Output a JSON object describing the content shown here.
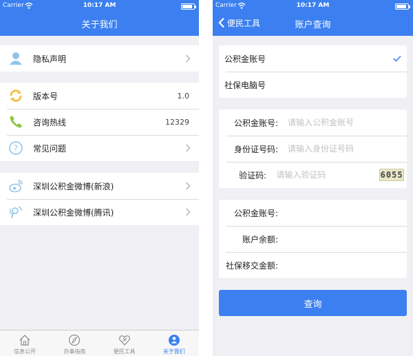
{
  "left": {
    "status": {
      "carrier": "Carrier",
      "time": "10:17 AM",
      "battery_level": 0.9
    },
    "nav_title": "关于我们",
    "groups": [
      [
        {
          "label": "隐私声明",
          "icon": "user-icon",
          "chevron": true
        }
      ],
      [
        {
          "label": "版本号",
          "icon": "refresh-icon",
          "value": "1.0"
        },
        {
          "label": "咨询热线",
          "icon": "phone-icon",
          "value": "12329"
        },
        {
          "label": "常见问题",
          "icon": "question-icon",
          "chevron": true
        }
      ],
      [
        {
          "label": "深圳公积金微博(新浪)",
          "icon": "sina-weibo-icon",
          "chevron": true
        },
        {
          "label": "深圳公积金微博(腾讯)",
          "icon": "tencent-weibo-icon",
          "chevron": true
        }
      ]
    ],
    "tabs": [
      {
        "label": "信息公开",
        "icon": "home-icon"
      },
      {
        "label": "办事指南",
        "icon": "compass-icon"
      },
      {
        "label": "便民工具",
        "icon": "heart-tools-icon"
      },
      {
        "label": "关于我们",
        "icon": "about-icon",
        "active": true
      }
    ]
  },
  "right": {
    "status": {
      "carrier": "Carrier",
      "time": "10:17 AM",
      "battery_level": 0.9
    },
    "back_label": "便民工具",
    "nav_title": "账户查询",
    "options": [
      {
        "label": "公积金账号",
        "selected": true
      },
      {
        "label": "社保电脑号",
        "selected": false
      }
    ],
    "form": {
      "account": {
        "label": "公积金账号:",
        "placeholder": "请输入公积金账号"
      },
      "id_number": {
        "label": "身份证号码:",
        "placeholder": "请输入身份证号码"
      },
      "captcha": {
        "label": "验证码:",
        "placeholder": "请输入验证码",
        "code": "6055"
      }
    },
    "results": [
      {
        "label": "公积金账号:"
      },
      {
        "label": "账户余额:"
      },
      {
        "label": "社保移交金额:"
      }
    ],
    "query_button": "查询",
    "colors": {
      "accent": "#3b7ff0",
      "background": "#efeff4"
    }
  }
}
